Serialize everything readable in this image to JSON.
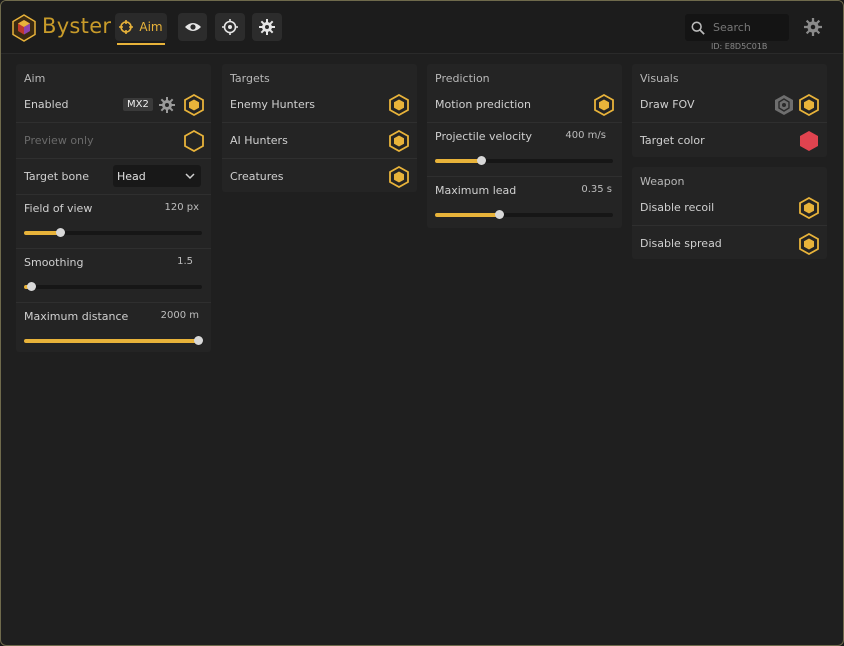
{
  "app": {
    "brand": "Byster",
    "id_text": "ID: E8D5C01B"
  },
  "tabs": [
    {
      "label": "Aim",
      "icon": "crosshair-icon",
      "active": true
    },
    {
      "label": "",
      "icon": "eye-icon",
      "active": false
    },
    {
      "label": "",
      "icon": "target-icon",
      "active": false
    },
    {
      "label": "",
      "icon": "gear-icon",
      "active": false
    }
  ],
  "search": {
    "placeholder": "Search",
    "value": ""
  },
  "aim": {
    "title": "Aim",
    "enabled_label": "Enabled",
    "key_badge": "MX2",
    "preview_label": "Preview only",
    "bone_label": "Target bone",
    "bone_value": "Head",
    "fov_label": "Field of view",
    "fov_value": "120 px",
    "fov_fill": 0.2,
    "smoothing_label": "Smoothing",
    "smoothing_value": "1.5",
    "smoothing_fill": 0.04,
    "distance_label": "Maximum distance",
    "distance_value": "2000 m",
    "distance_fill": 1.0
  },
  "targets": {
    "title": "Targets",
    "items": [
      "Enemy Hunters",
      "AI Hunters",
      "Creatures"
    ]
  },
  "prediction": {
    "title": "Prediction",
    "motion_label": "Motion prediction",
    "velocity_label": "Projectile velocity",
    "velocity_value": "400 m/s",
    "velocity_fill": 0.26,
    "lead_label": "Maximum lead",
    "lead_value": "0.35 s",
    "lead_fill": 0.36
  },
  "visuals": {
    "title": "Visuals",
    "fov_label": "Draw FOV",
    "color_label": "Target color",
    "target_color": "#e0434f"
  },
  "weapon": {
    "title": "Weapon",
    "recoil_label": "Disable recoil",
    "spread_label": "Disable spread"
  },
  "colors": {
    "accent": "#e8b33a",
    "target": "#e0434f"
  }
}
